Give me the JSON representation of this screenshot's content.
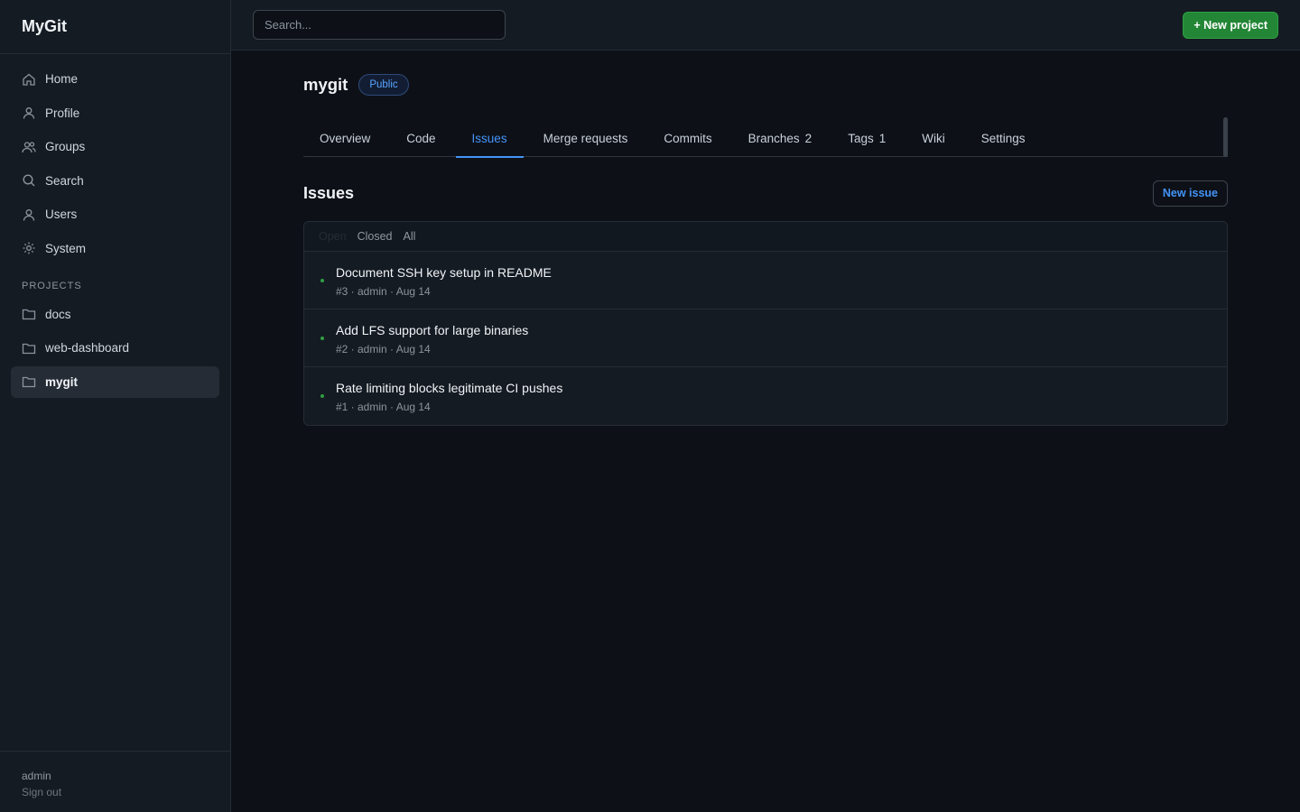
{
  "app": {
    "title": "MyGit"
  },
  "sidebar": {
    "nav": [
      {
        "label": "Home",
        "icon": "home-icon"
      },
      {
        "label": "Profile",
        "icon": "user-icon"
      },
      {
        "label": "Groups",
        "icon": "users-icon"
      },
      {
        "label": "Search",
        "icon": "search-icon"
      },
      {
        "label": "Users",
        "icon": "user-icon"
      },
      {
        "label": "System",
        "icon": "gear-icon"
      }
    ],
    "projects_label": "PROJECTS",
    "projects": [
      {
        "label": "docs",
        "icon": "folder-icon"
      },
      {
        "label": "web-dashboard",
        "icon": "folder-icon"
      },
      {
        "label": "mygit",
        "icon": "folder-icon",
        "active": true
      }
    ],
    "footer": {
      "user": "admin",
      "signout": "Sign out"
    }
  },
  "topbar": {
    "search_placeholder": "Search...",
    "new_project_label": "+ New project"
  },
  "repo": {
    "name": "mygit",
    "visibility": "Public",
    "tabs": [
      {
        "label": "Overview"
      },
      {
        "label": "Code"
      },
      {
        "label": "Issues",
        "active": true
      },
      {
        "label": "Merge requests"
      },
      {
        "label": "Commits"
      },
      {
        "label": "Branches",
        "count": "2"
      },
      {
        "label": "Tags",
        "count": "1"
      },
      {
        "label": "Wiki"
      },
      {
        "label": "Settings"
      }
    ]
  },
  "issues": {
    "title": "Issues",
    "new_issue_label": "New issue",
    "filters": [
      "Open",
      "Closed",
      "All"
    ],
    "selected_filter": "Open",
    "items": [
      {
        "title": "Document SSH key setup in README",
        "meta": "#3 · admin · Aug 14",
        "state": "open"
      },
      {
        "title": "Add LFS support for large binaries",
        "meta": "#2 · admin · Aug 14",
        "state": "open"
      },
      {
        "title": "Rate limiting blocks legitimate CI pushes",
        "meta": "#1 · admin · Aug 14",
        "state": "open"
      }
    ]
  },
  "colors": {
    "accent": "#4493f8",
    "primary_button": "#238636",
    "open_status": "#2ea043",
    "background": "#0d1117",
    "sidebar_bg": "#151b23"
  }
}
